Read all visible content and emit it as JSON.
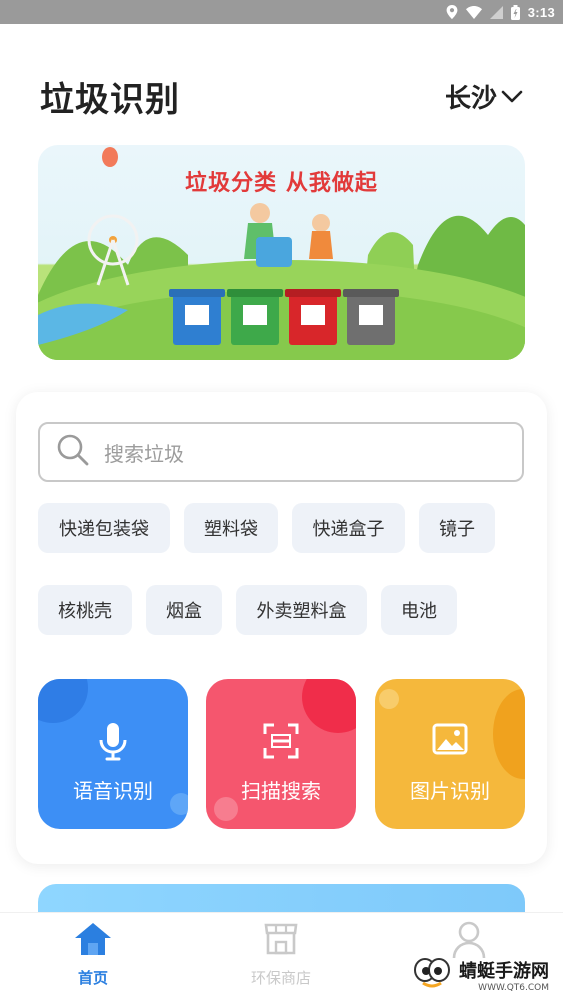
{
  "status_bar": {
    "time": "3:13"
  },
  "header": {
    "title": "垃圾识别",
    "city": "长沙"
  },
  "banner": {
    "slogan": "垃圾分类   从我做起"
  },
  "search": {
    "placeholder": "搜索垃圾"
  },
  "tags": [
    "快递包装袋",
    "塑料袋",
    "快递盒子",
    "镜子",
    "核桃壳",
    "烟盒",
    "外卖塑料盒",
    "电池"
  ],
  "actions": [
    {
      "label": "语音识别",
      "icon": "microphone-icon",
      "color": "#3d8ff5"
    },
    {
      "label": "扫描搜索",
      "icon": "scan-icon",
      "color": "#f5566e"
    },
    {
      "label": "图片识别",
      "icon": "image-icon",
      "color": "#f5b83c"
    }
  ],
  "tabbar": {
    "items": [
      {
        "label": "首页",
        "icon": "home-icon",
        "active": true
      },
      {
        "label": "环保商店",
        "icon": "store-icon",
        "active": false
      },
      {
        "label": "",
        "icon": "user-icon",
        "active": false
      }
    ],
    "active_color": "#2b7fe0",
    "inactive_color": "#c9c9c9"
  },
  "watermark": {
    "brand": "蜻蜓手游网",
    "url": "WWW.QT6.COM"
  }
}
